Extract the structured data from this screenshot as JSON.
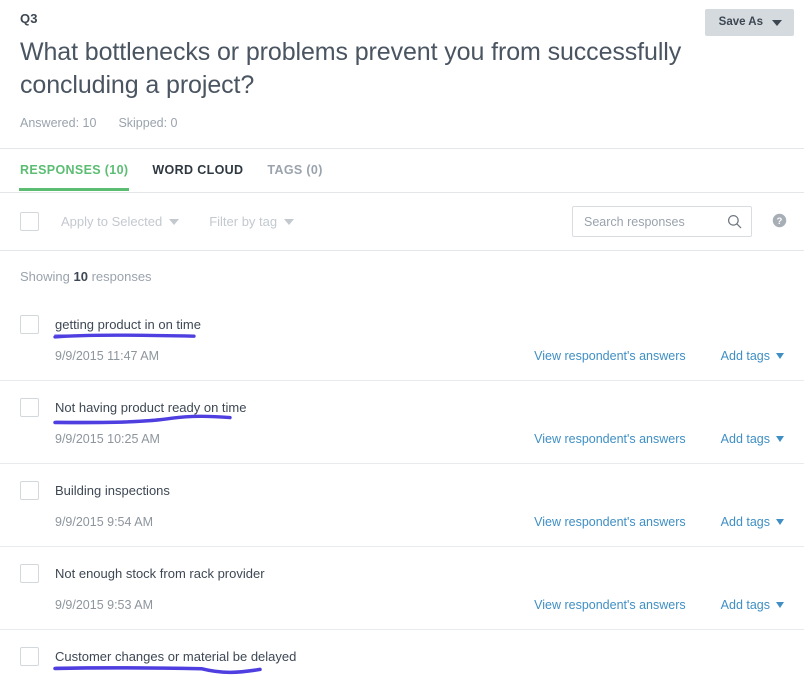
{
  "header": {
    "question_number": "Q3",
    "question_title": "What bottlenecks or problems prevent you from successfully concluding a project?",
    "answered_label": "Answered: 10",
    "skipped_label": "Skipped: 0",
    "save_as_label": "Save As"
  },
  "tabs": [
    {
      "label": "RESPONSES (10)",
      "state": "active"
    },
    {
      "label": "WORD CLOUD",
      "state": "dark"
    },
    {
      "label": "TAGS (0)",
      "state": "muted"
    }
  ],
  "toolbar": {
    "apply_to_selected_label": "Apply to Selected",
    "filter_by_tag_label": "Filter by tag",
    "search_placeholder": "Search responses",
    "search_value": "",
    "search_icon": "search-icon",
    "help_icon": "help-circle-icon"
  },
  "showing": {
    "prefix": "Showing ",
    "count": "10",
    "suffix": " responses"
  },
  "row_actions": {
    "view_answers_label": "View respondent's answers",
    "add_tags_label": "Add tags"
  },
  "annotation_color": "#4f3fe0",
  "accent_green": "#5bbd72",
  "link_blue": "#3f8fc4",
  "responses": [
    {
      "text": "getting product in on time",
      "date": "9/9/2015 11:47 AM",
      "annotation": "straight"
    },
    {
      "text": "Not having product ready on time",
      "date": "9/9/2015 10:25 AM",
      "annotation": "curved"
    },
    {
      "text": "Building inspections",
      "date": "9/9/2015 9:54 AM",
      "annotation": "none"
    },
    {
      "text": "Not enough stock from rack provider",
      "date": "9/9/2015 9:53 AM",
      "annotation": "none"
    },
    {
      "text": "Customer changes or material be delayed",
      "date": "",
      "annotation": "wavy"
    }
  ]
}
